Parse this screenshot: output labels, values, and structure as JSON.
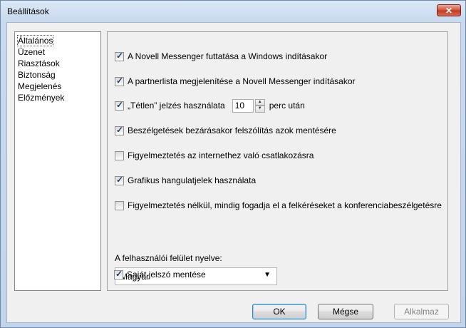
{
  "window": {
    "title": "Beállítások",
    "close_glyph": "✕"
  },
  "nav": {
    "items": [
      {
        "label": "Általános",
        "selected": true
      },
      {
        "label": "Üzenet"
      },
      {
        "label": "Riasztások"
      },
      {
        "label": "Biztonság"
      },
      {
        "label": "Megjelenés"
      },
      {
        "label": "Előzmények"
      }
    ]
  },
  "options": [
    {
      "label": "A Novell Messenger futtatása a Windows indításakor",
      "checked": true
    },
    {
      "label": "A partnerlista megjelenítése a Novell Messenger indításakor",
      "checked": true
    },
    {
      "label": "„Tétlen” jelzés használata",
      "checked": true,
      "spinner_value": "10",
      "suffix": "perc után"
    },
    {
      "label": "Beszélgetések bezárásakor felszólítás azok mentésére",
      "checked": true
    },
    {
      "label": "Figyelmeztetés az internethez való csatlakozásra",
      "checked": false
    },
    {
      "label": "Grafikus hangulatjelek használata",
      "checked": true
    },
    {
      "label": "Figyelmeztetés nélkül, mindig fogadja el a felkéréseket a konferenciabeszélgetésre",
      "checked": false
    }
  ],
  "language": {
    "label": "A felhasználói felület nyelve:",
    "value": "Magyar"
  },
  "save_password": {
    "label": "Saját jelszó mentése",
    "checked": true
  },
  "buttons": {
    "ok": "OK",
    "cancel": "Mégse",
    "apply": "Alkalmaz"
  },
  "glyphs": {
    "check": "✓",
    "spin_up": "▲",
    "spin_down": "▼",
    "dropdown": "▼"
  }
}
